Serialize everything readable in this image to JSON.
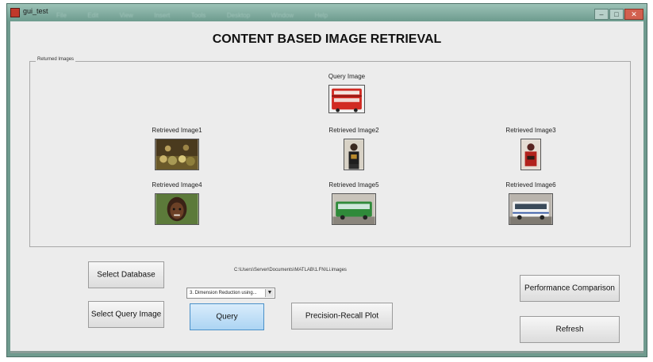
{
  "window": {
    "title": "gui_test",
    "menu": [
      "File",
      "Edit",
      "View",
      "Insert",
      "Tools",
      "Desktop",
      "Window",
      "Help"
    ],
    "controls": {
      "minimize": "–",
      "maximize": "□",
      "close": "✕"
    }
  },
  "app": {
    "title": "CONTENT BASED IMAGE RETRIEVAL"
  },
  "panel": {
    "legend": "Returned Images",
    "query": {
      "label": "Query Image",
      "thumb": "red-bus-image"
    },
    "retrieved": [
      {
        "label": "Retrieved Image1",
        "thumb": "crowd-image"
      },
      {
        "label": "Retrieved Image2",
        "thumb": "person-standing-image"
      },
      {
        "label": "Retrieved Image3",
        "thumb": "red-figure-image"
      },
      {
        "label": "Retrieved Image4",
        "thumb": "face-portrait-image"
      },
      {
        "label": "Retrieved Image5",
        "thumb": "green-bus-image"
      },
      {
        "label": "Retrieved Image6",
        "thumb": "white-bus-image"
      }
    ]
  },
  "controls": {
    "select_database": "Select Database",
    "select_query_image": "Select Query Image",
    "database_path": "C:\\Users\\Server\\Documents\\MATLAB\\1.FN\\Li.images",
    "method_dropdown": "3. Dimension Reduction using...",
    "query": "Query",
    "precision_recall": "Precision-Recall Plot",
    "performance_comparison": "Performance Comparison",
    "refresh": "Refresh"
  },
  "colors": {
    "titlebar": "#6f9a8e",
    "client_bg": "#ececec",
    "query_button": "#acd4f3"
  }
}
